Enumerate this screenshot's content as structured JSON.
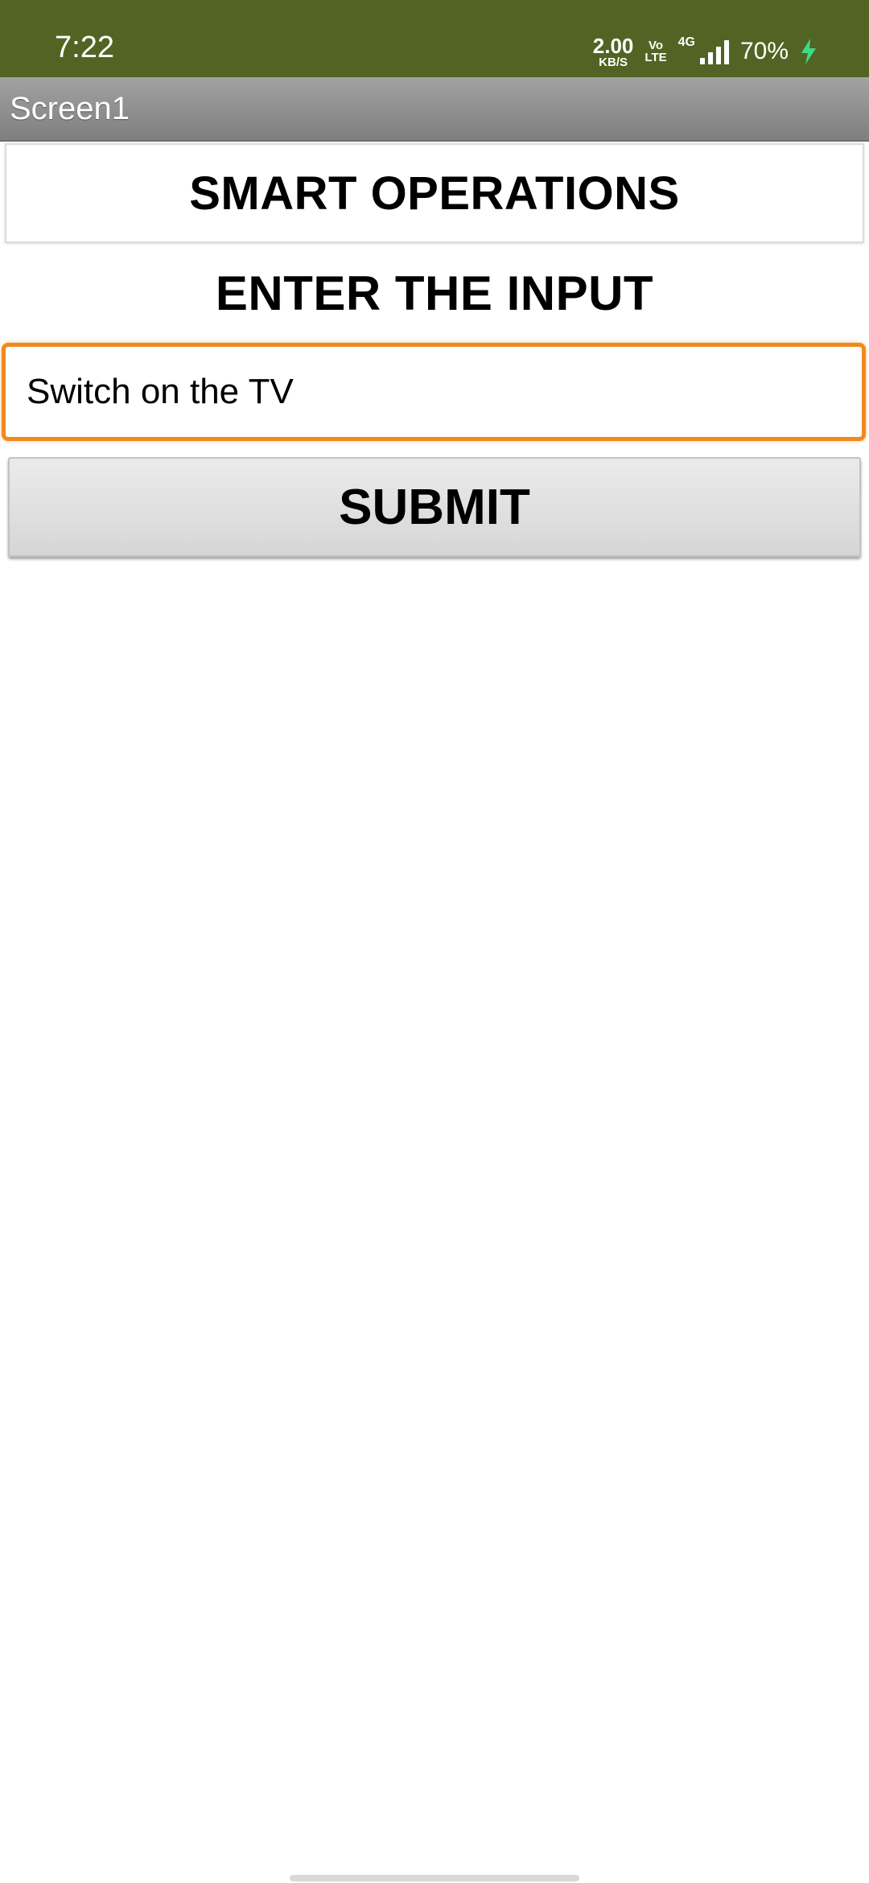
{
  "status_bar": {
    "time": "7:22",
    "net_speed_value": "2.00",
    "net_speed_unit": "KB/S",
    "volte_top": "Vo",
    "volte_bottom": "LTE",
    "network_type": "4G",
    "battery": "70%",
    "background_color": "#526423",
    "charging_color": "#3ddc84",
    "icons": [
      "signal-icon",
      "charging-bolt-icon"
    ]
  },
  "app_bar": {
    "title": "Screen1"
  },
  "main": {
    "heading": "SMART OPERATIONS",
    "input_label": "ENTER THE INPUT",
    "input_value": "Switch on the TV",
    "submit_label": "SUBMIT",
    "focus_color": "#f08a1f"
  }
}
